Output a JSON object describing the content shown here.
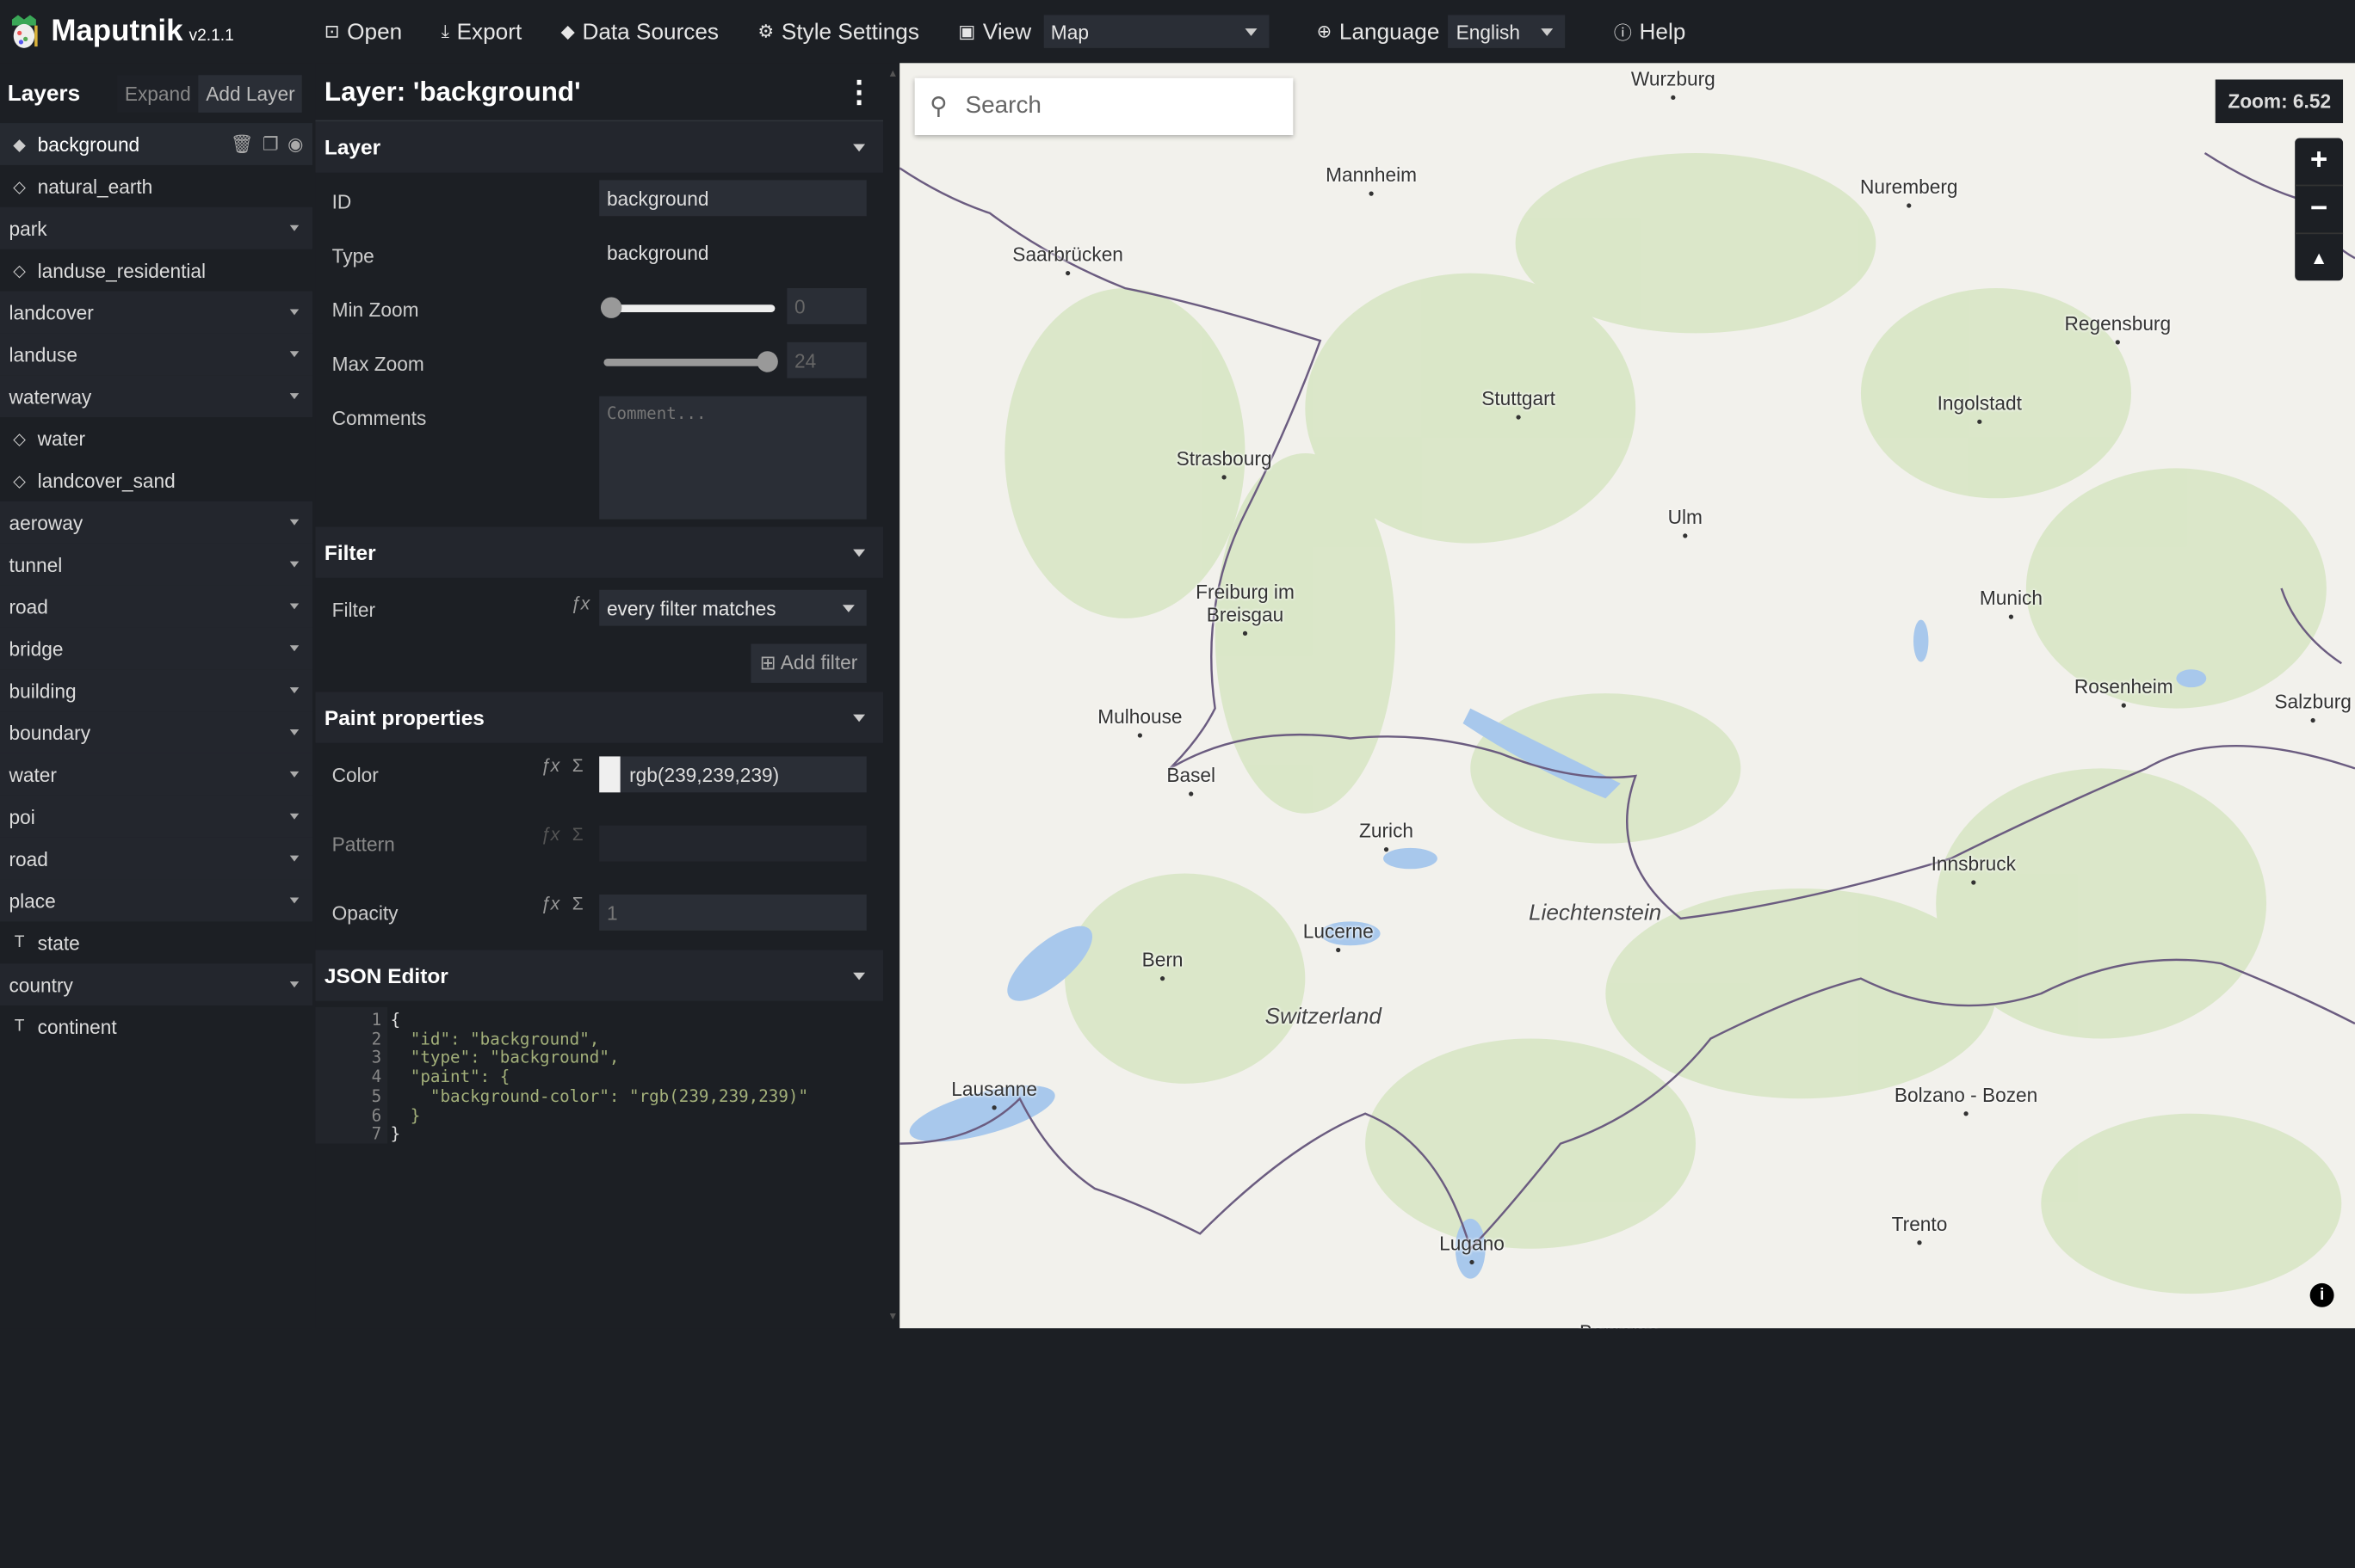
{
  "app": {
    "name": "Maputnik",
    "version": "v2.1.1"
  },
  "toolbar": {
    "open": "Open",
    "export": "Export",
    "data_sources": "Data Sources",
    "style_settings": "Style Settings",
    "view": "View",
    "view_value": "Map",
    "language": "Language",
    "language_value": "English",
    "help": "Help"
  },
  "layers_panel": {
    "title": "Layers",
    "expand": "Expand",
    "add_layer": "Add Layer",
    "items": [
      {
        "label": "background",
        "kind": "layer",
        "icon": "diamond-filled-icon",
        "selected": true
      },
      {
        "label": "natural_earth",
        "kind": "layer",
        "icon": "diamond-outline-icon"
      },
      {
        "label": "park",
        "kind": "group"
      },
      {
        "label": "landuse_residential",
        "kind": "layer",
        "icon": "diamond-outline-icon"
      },
      {
        "label": "landcover",
        "kind": "group"
      },
      {
        "label": "landuse",
        "kind": "group"
      },
      {
        "label": "waterway",
        "kind": "group"
      },
      {
        "label": "water",
        "kind": "layer",
        "icon": "diamond-outline-icon"
      },
      {
        "label": "landcover_sand",
        "kind": "layer",
        "icon": "diamond-outline-icon"
      },
      {
        "label": "aeroway",
        "kind": "group"
      },
      {
        "label": "tunnel",
        "kind": "group"
      },
      {
        "label": "road",
        "kind": "group"
      },
      {
        "label": "bridge",
        "kind": "group"
      },
      {
        "label": "building",
        "kind": "group"
      },
      {
        "label": "boundary",
        "kind": "group"
      },
      {
        "label": "water",
        "kind": "group"
      },
      {
        "label": "poi",
        "kind": "group"
      },
      {
        "label": "road",
        "kind": "group"
      },
      {
        "label": "place",
        "kind": "group"
      },
      {
        "label": "state",
        "kind": "layer",
        "icon": "text-icon"
      },
      {
        "label": "country",
        "kind": "group"
      },
      {
        "label": "continent",
        "kind": "layer",
        "icon": "text-icon"
      }
    ]
  },
  "editor": {
    "title": "Layer: 'background'",
    "layer_section": "Layer",
    "id_label": "ID",
    "id_value": "background",
    "type_label": "Type",
    "type_value": "background",
    "min_zoom_label": "Min Zoom",
    "min_zoom_value": "0",
    "max_zoom_label": "Max Zoom",
    "max_zoom_value": "24",
    "comments_label": "Comments",
    "comments_placeholder": "Comment...",
    "filter_section": "Filter",
    "filter_label": "Filter",
    "filter_value": "every filter matches",
    "add_filter": "Add filter",
    "paint_section": "Paint properties",
    "color_label": "Color",
    "color_value": "rgb(239,239,239)",
    "pattern_label": "Pattern",
    "opacity_label": "Opacity",
    "opacity_value": "1",
    "json_section": "JSON Editor",
    "json_lines": [
      "{",
      "  \"id\": \"background\",",
      "  \"type\": \"background\",",
      "  \"paint\": {",
      "    \"background-color\": \"rgb(239,239,239)\"",
      "  }",
      "}"
    ]
  },
  "map": {
    "search_placeholder": "Search",
    "zoom_label": "Zoom: 6.52",
    "cities": [
      "Wurzburg",
      "Mannheim",
      "Nuremberg",
      "Saarbrücken",
      "Regensburg",
      "Stuttgart",
      "Ingolstadt",
      "Strasbourg",
      "Ulm",
      "Munich",
      "Freiburg im\nBreisgau",
      "Rosenheim",
      "Salzburg",
      "Mulhouse",
      "Basel",
      "Zurich",
      "Innsbruck",
      "Liechtenstein",
      "Lucerne",
      "Bern",
      "Switzerland",
      "Lausanne",
      "Bolzano - Bozen",
      "Trento",
      "Lugano",
      "Bergamo"
    ]
  },
  "colors": {
    "background": "#1c1f24",
    "panel": "#23262d",
    "input": "#2a2e36",
    "map_bg": "#f2f1ec",
    "forest": "#d7e6c2",
    "water": "#9fc3ea",
    "border": "#5a4f6e",
    "json_string": "#a3b07a"
  }
}
